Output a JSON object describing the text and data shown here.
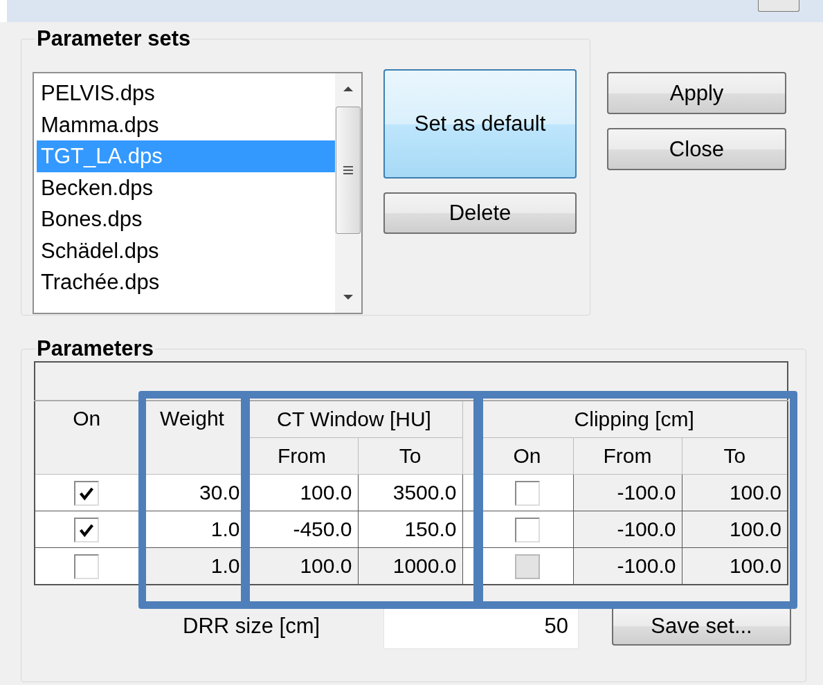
{
  "parameter_sets": {
    "title": "Parameter sets",
    "items": [
      {
        "label": "PELVIS.dps",
        "selected": false
      },
      {
        "label": "Mamma.dps",
        "selected": false
      },
      {
        "label": "TGT_LA.dps",
        "selected": true
      },
      {
        "label": "Becken.dps",
        "selected": false
      },
      {
        "label": "Bones.dps",
        "selected": false
      },
      {
        "label": "Schädel.dps",
        "selected": false
      },
      {
        "label": "Trachée.dps",
        "selected": false
      }
    ],
    "buttons": [
      {
        "label": "Set as default",
        "focused": true
      },
      {
        "label": "Delete",
        "focused": false
      }
    ]
  },
  "dialog_buttons": [
    {
      "label": "Apply"
    },
    {
      "label": "Close"
    }
  ],
  "parameters": {
    "title": "Parameters",
    "columns": [
      {
        "label": "On",
        "highlighted": false
      },
      {
        "label": "Weight",
        "highlighted": true
      },
      {
        "label": "CT Window [HU]",
        "highlighted": true,
        "sub": [
          "From",
          "To"
        ]
      },
      {
        "label": "Clipping [cm]",
        "highlighted": true,
        "sub": [
          "On",
          "From",
          "To"
        ]
      }
    ],
    "rows": [
      {
        "on": true,
        "weight": "30.0",
        "ct_from": "100.0",
        "ct_to": "3500.0",
        "clip_on": false,
        "clip_disabled": false,
        "clip_from": "-100.0",
        "clip_to": "100.0"
      },
      {
        "on": true,
        "weight": "1.0",
        "ct_from": "-450.0",
        "ct_to": "150.0",
        "clip_on": false,
        "clip_disabled": false,
        "clip_from": "-100.0",
        "clip_to": "100.0"
      },
      {
        "on": false,
        "weight": "1.0",
        "ct_from": "100.0",
        "ct_to": "1000.0",
        "clip_on": false,
        "clip_disabled": true,
        "clip_from": "-100.0",
        "clip_to": "100.0"
      }
    ],
    "drr_size": {
      "label": "DRR size [cm]",
      "value": "50"
    },
    "save_button": "Save set..."
  }
}
